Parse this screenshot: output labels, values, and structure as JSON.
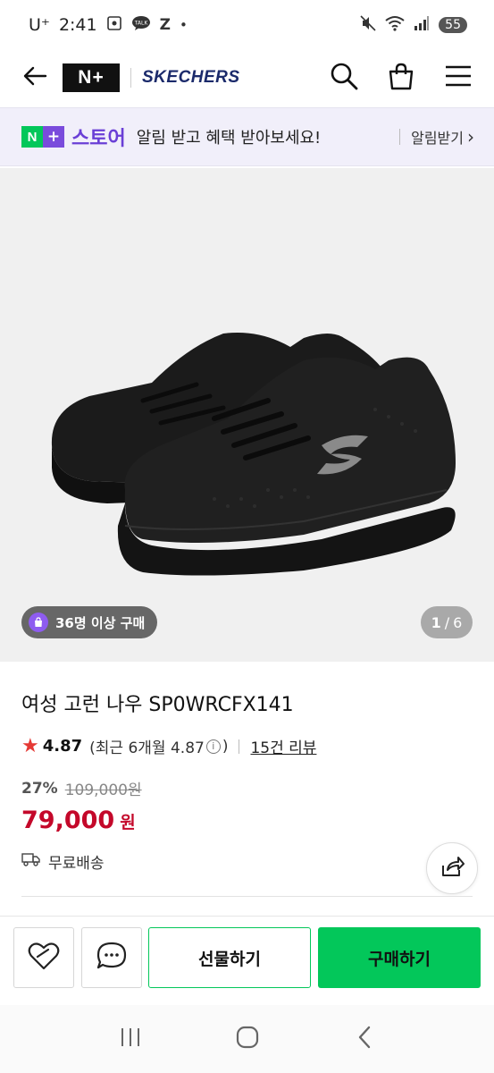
{
  "status_bar": {
    "carrier": "U⁺",
    "time": "2:41",
    "notif_talk": "TALK",
    "notif_z": "Z",
    "notif_dot": "•",
    "battery": "55"
  },
  "header": {
    "nplus_logo": "N+",
    "brand": "SKECHERS",
    "icons": [
      "back-arrow-icon",
      "search-icon",
      "shopping-bag-icon",
      "menu-icon"
    ]
  },
  "store_banner": {
    "badge_n": "N",
    "badge_plus": "+",
    "store_name": "스토어",
    "message": "알림 받고 혜택 받아보세요!",
    "cta": "알림받기",
    "cta_chevron": "›"
  },
  "product_image": {
    "buyers_badge": "36명 이상 구매",
    "page_current": "1",
    "page_sep": "/",
    "page_total": "6"
  },
  "product": {
    "title": "여성 고런 나우 SP0WRCFX141",
    "rating_star": "★",
    "rating": "4.87",
    "recent_rating_prefix": "(최근 6개월 4.87",
    "recent_rating_info": "i",
    "recent_rating_suffix": ")",
    "review_count": "15건 리뷰",
    "discount_rate": "27%",
    "original_price": "109,000원",
    "sale_price": "79,000",
    "price_unit": "원",
    "shipping": "무료배송"
  },
  "actions": {
    "gift": "선물하기",
    "buy": "구매하기"
  },
  "colors": {
    "naver_green": "#03c75a",
    "store_purple": "#6a3fd6",
    "price_red": "#c4082a",
    "banner_bg": "#f1effa"
  }
}
